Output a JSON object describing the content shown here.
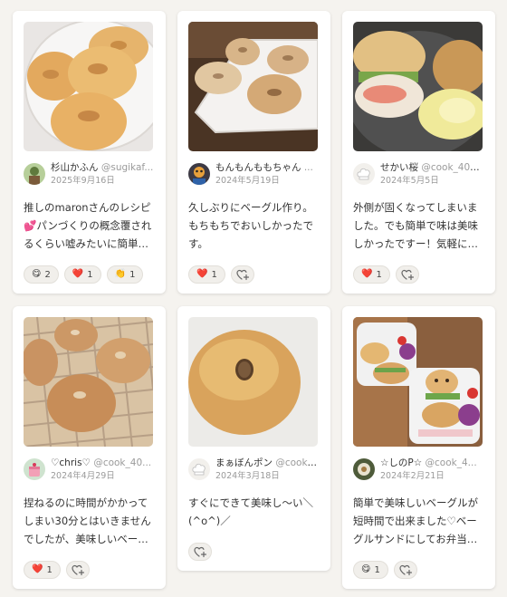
{
  "cards": [
    {
      "author": "杉山かふん",
      "handle": "@sugikaf...",
      "date": "2025年9月16日",
      "comment": "推しのmaronさんのレシピ💕パンづくりの概念覆されるくらい嘘みたいに簡単…",
      "reactions": [
        {
          "emoji": "😋",
          "icon": "yum-face-icon",
          "count": "2"
        },
        {
          "emoji": "❤️",
          "icon": "heart-icon",
          "count": "1"
        },
        {
          "emoji": "👏",
          "icon": "clap-icon",
          "count": "1"
        }
      ]
    },
    {
      "author": "もんもんももちゃん",
      "handle": "...",
      "date": "2024年5月19日",
      "comment": "久しぶりにベーグル作り。もちもちでおいしかったです。",
      "reactions": [
        {
          "emoji": "❤️",
          "icon": "heart-icon",
          "count": "1"
        }
      ]
    },
    {
      "author": "せかい桜",
      "handle": "@cook_409...",
      "date": "2024年5月5日",
      "comment": "外側が固くなってしまいました。でも簡単で味は美味しかったですー！気軽に…",
      "reactions": [
        {
          "emoji": "❤️",
          "icon": "heart-icon",
          "count": "1"
        }
      ]
    },
    {
      "author": "♡chris♡",
      "handle": "@cook_40...",
      "date": "2024年4月29日",
      "comment": "捏ねるのに時間がかかってしまい30分とはいきませんでしたが、美味しいベー…",
      "reactions": [
        {
          "emoji": "❤️",
          "icon": "heart-icon",
          "count": "1"
        }
      ]
    },
    {
      "author": "まぁぼんポン",
      "handle": "@cook_...",
      "date": "2024年3月18日",
      "comment": "すぐにできて美味し〜い＼(^o^)／",
      "reactions": []
    },
    {
      "author": "☆しのP☆",
      "handle": "@cook_4...",
      "date": "2024年2月21日",
      "comment": "簡単で美味しいベーグルが短時間で出来ました♡ベーグルサンドにしてお弁当…",
      "reactions": [
        {
          "emoji": "😋",
          "icon": "yum-face-icon",
          "count": "1"
        }
      ]
    }
  ]
}
